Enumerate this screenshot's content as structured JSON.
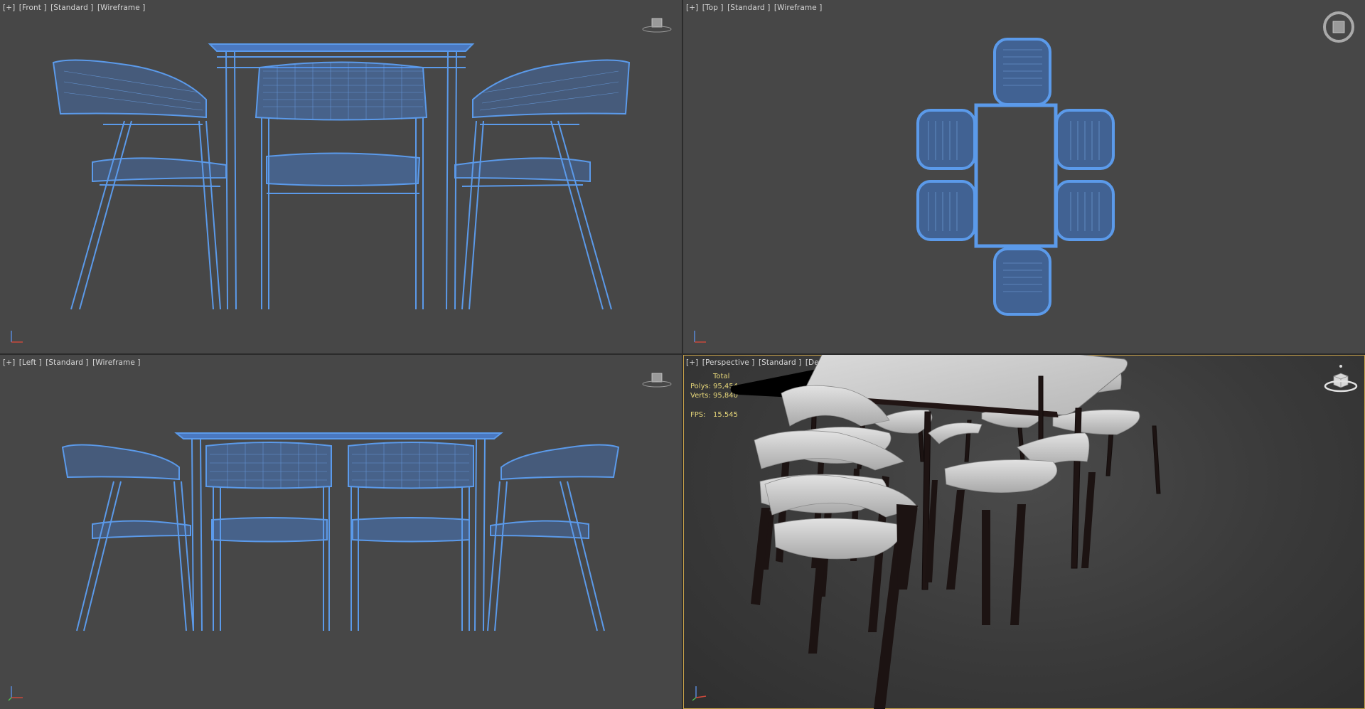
{
  "viewports": {
    "front": {
      "label_parts": [
        "[+]",
        "[Front ]",
        "[Standard ]",
        "[Wireframe ]"
      ]
    },
    "top": {
      "label_parts": [
        "[+]",
        "[Top ]",
        "[Standard ]",
        "[Wireframe ]"
      ]
    },
    "left": {
      "label_parts": [
        "[+]",
        "[Left ]",
        "[Standard ]",
        "[Wireframe ]"
      ]
    },
    "perspective": {
      "label_parts": [
        "[+]",
        "[Perspective ]",
        "[Standard ]",
        "[Default Shading ]"
      ]
    }
  },
  "stats": {
    "total_label": "Total",
    "polys_label": "Polys:",
    "polys_value": "95,454",
    "verts_label": "Verts:",
    "verts_value": "95,840",
    "fps_label": "FPS:",
    "fps_value": "15.545"
  },
  "colors": {
    "viewport_bg": "#474747",
    "wireframe": "#5b9aea",
    "active_border": "#c9a24a",
    "stats_text": "#e7d77a"
  },
  "icons": [
    "viewcube-icon",
    "steering-wheel-icon",
    "axis-tripod-icon"
  ]
}
